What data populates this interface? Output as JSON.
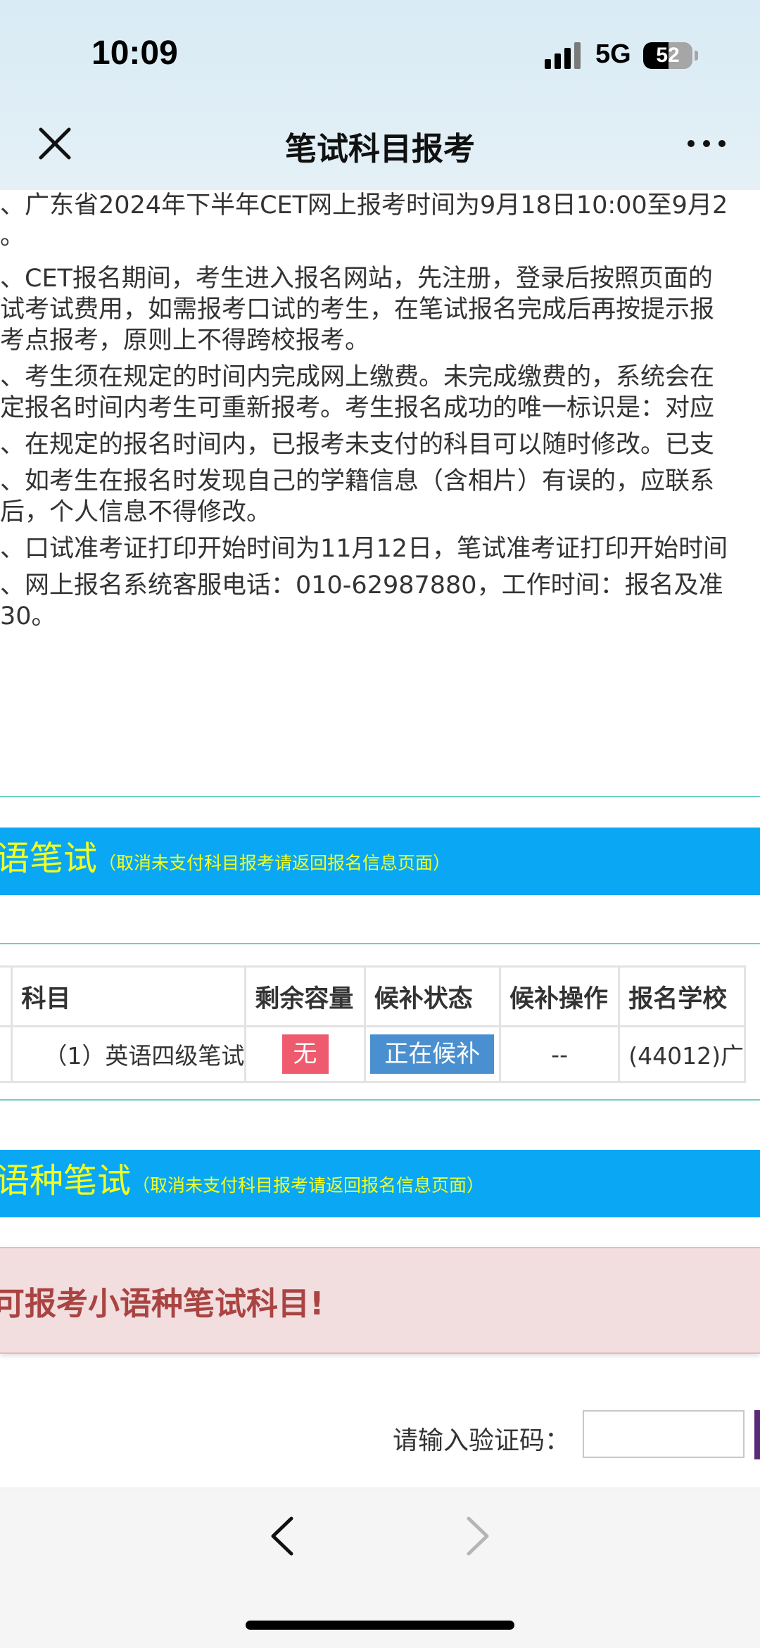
{
  "status_bar": {
    "time": "10:09",
    "network": "5G",
    "battery": "52",
    "battery_level": 0.52
  },
  "title_bar": {
    "title": "笔试科目报考",
    "close_icon": "close-icon",
    "more_icon": "more-dots-icon"
  },
  "notice": {
    "lines": [
      "、广东省2024年下半年CET网上报考时间为9月18日10:00至9月2",
      "。",
      "、CET报名期间，考生进入报名网站，先注册，登录后按照页面的",
      "试考试费用，如需报考口试的考生，在笔试报名完成后再按提示报",
      "考点报考，原则上不得跨校报考。",
      "、考生须在规定的时间内完成网上缴费。未完成缴费的，系统会在",
      "定报名时间内考生可重新报考。考生报名成功的唯一标识是：对应",
      "、在规定的报名时间内，已报考未支付的科目可以随时修改。已支",
      "、如考生在报名时发现自己的学籍信息（含相片）有误的，应联系",
      "后，个人信息不得修改。",
      "、口试准考证打印开始时间为11月12日，笔试准考证打印开始时间",
      "、网上报名系统客服电话：010-62987880，工作时间：报名及准",
      "30。"
    ]
  },
  "section_english": {
    "title": "语笔试",
    "hint": "（取消未支付科目报考请返回报名信息页面）"
  },
  "table": {
    "headers": [
      "",
      "科目",
      "剩余容量",
      "候补状态",
      "候补操作",
      "报名学校"
    ],
    "rows": [
      {
        "subject": "（1）英语四级笔试",
        "capacity": "无",
        "waitlist_status": "正在候补",
        "waitlist_action": "--",
        "school": "(44012)广"
      }
    ]
  },
  "section_minor": {
    "title": "语种笔试",
    "hint": "（取消未支付科目报考请返回报名信息页面）"
  },
  "alert": {
    "message": "可报考小语种笔试科目!"
  },
  "captcha": {
    "label": "请输入验证码：",
    "value": "",
    "placeholder": ""
  },
  "bottom_nav": {
    "back_icon": "chevron-left-icon",
    "forward_icon": "chevron-right-icon"
  },
  "colors": {
    "section_bar": "#0aa7f5",
    "section_text": "#f2ff1f",
    "teal_divider": "#6fcfbf",
    "badge_none": "#ef5b6e",
    "badge_waiting": "#4a90d0",
    "alert_bg": "#f2dede",
    "alert_text": "#a94442"
  }
}
